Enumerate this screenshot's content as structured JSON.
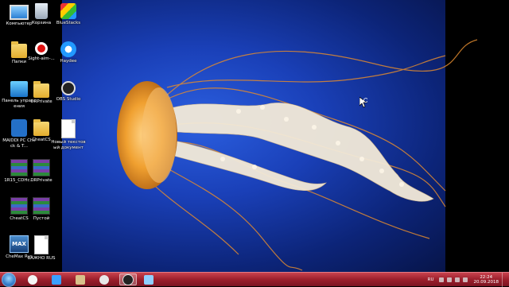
{
  "desktop": {
    "icons": [
      {
        "label": "Компьютер"
      },
      {
        "label": "Корзина"
      },
      {
        "label": "BlueStacks"
      },
      {
        "label": "Папки"
      },
      {
        "label": "Sight-aim-..."
      },
      {
        "label": "Haydee"
      },
      {
        "label": "Панель управления"
      },
      {
        "label": "DRPrivate"
      },
      {
        "label": "OBS Studio"
      },
      {
        "label": "MAIDDI PC Check & T..."
      },
      {
        "label": "CheatCS"
      },
      {
        "label": "Новый текстовый документ"
      },
      {
        "label": "1R15_CDHc..."
      },
      {
        "label": "DRPrivate"
      },
      {
        "label": "CheatCS"
      },
      {
        "label": "Пустой"
      },
      {
        "label": "CheMax Rus"
      },
      {
        "label": "ВАЖНО RUS"
      }
    ],
    "cheatmax_badge": "MAX"
  },
  "taskbar": {
    "language": "RU",
    "time": "22:24",
    "date": "20.09.2018",
    "apps": [
      {
        "icon": "yandex-browser-icon",
        "color": "#f5f5f5"
      },
      {
        "icon": "app-blue-icon",
        "color": "#3aa0ff"
      },
      {
        "icon": "counter-strike-icon",
        "color": "#d8c08a"
      },
      {
        "icon": "paint-icon",
        "color": "#e8e8e8"
      },
      {
        "icon": "obs-icon",
        "color": "#222222"
      },
      {
        "icon": "window-icon",
        "color": "#8fcfff"
      }
    ],
    "accent": "#9c1f2c"
  },
  "wallpaper": {
    "subject": "jellyfish",
    "bg": "#1a40b8"
  }
}
